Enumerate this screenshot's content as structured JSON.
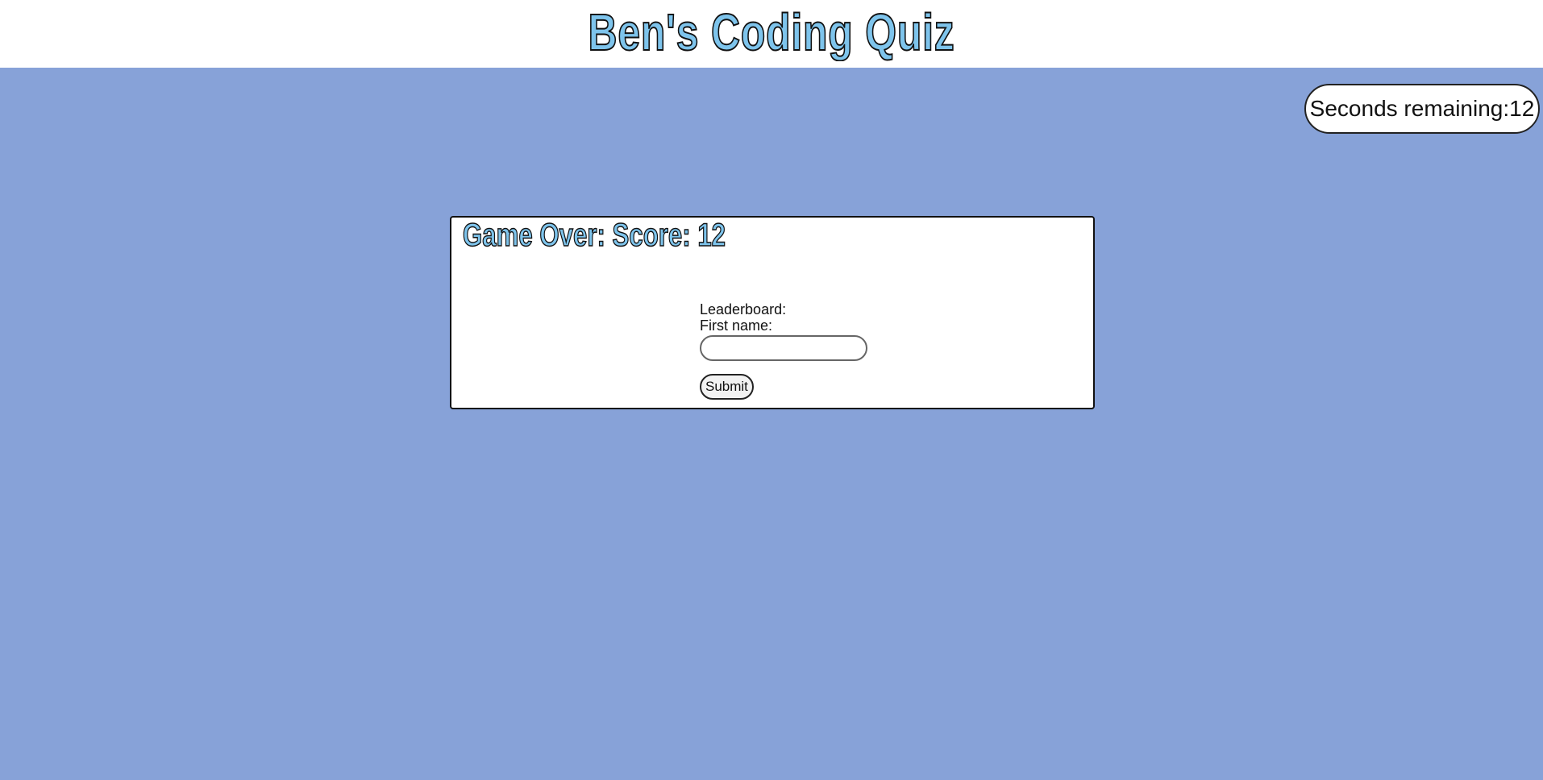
{
  "header": {
    "title": "Ben's Coding Quiz"
  },
  "timer": {
    "label": "Seconds remaining:",
    "value": "12"
  },
  "result": {
    "heading": "Game Over: Score: 12"
  },
  "leaderboard_form": {
    "leaderboard_label": "Leaderboard:",
    "first_name_label": "First name:",
    "first_name_value": "",
    "submit_label": "Submit"
  },
  "colors": {
    "page_background": "#87a2d8",
    "header_background": "#ffffff",
    "title_fill": "#7ec4ec",
    "title_outline": "#111111",
    "card_background": "#ffffff"
  }
}
